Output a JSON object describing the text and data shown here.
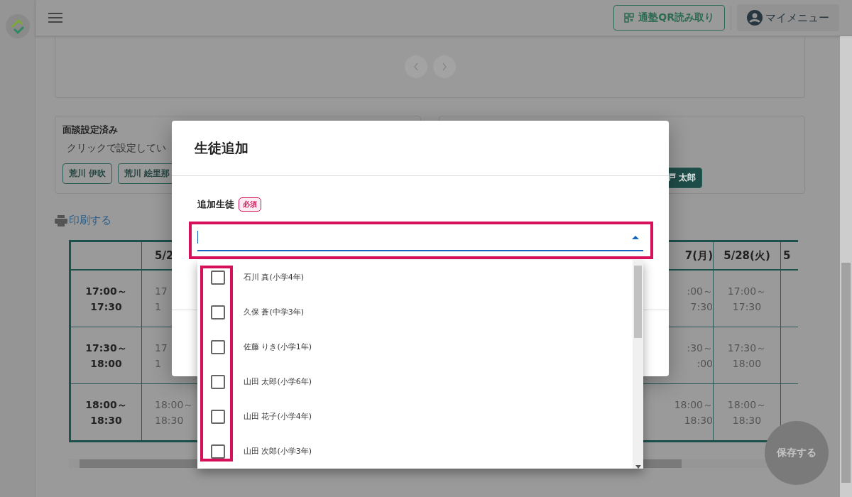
{
  "header": {
    "qr_button": "通塾QR読み取り",
    "my_menu": "マイメニュー"
  },
  "interview_set": {
    "title": "面談設定済み",
    "hint": "クリックで設定してい",
    "students": [
      "荒川 伊吹",
      "荒川 絵里那"
    ]
  },
  "other_panel": {
    "students": [
      "戸 太郎"
    ]
  },
  "print_link": "印刷する",
  "schedule": {
    "columns": [
      "",
      "5/2",
      "7(月)",
      "5/28(火)",
      "5"
    ],
    "rows": [
      {
        "cells": [
          [
            "17:00～",
            "17:30"
          ],
          [
            "17",
            "1"
          ],
          [
            ":00～",
            "7:30"
          ],
          [
            "17:00～",
            "17:30"
          ]
        ]
      },
      {
        "cells": [
          [
            "17:30～",
            "18:00"
          ],
          [
            "17",
            "1"
          ],
          [
            ":30～",
            ":00"
          ],
          [
            "17:30～",
            "18:00"
          ]
        ]
      },
      {
        "cells": [
          [
            "18:00～",
            "18:30"
          ],
          [
            "18:00～",
            "18:30"
          ],
          [
            "18:00～",
            "18:30"
          ],
          [
            "18:00～",
            "18:30"
          ]
        ]
      }
    ]
  },
  "save_button": {
    "label": "保存する",
    "disabled": true
  },
  "dialog": {
    "title": "生徒追加",
    "field": {
      "label": "追加生徒",
      "badge": "必須",
      "expanded": true
    },
    "options": [
      {
        "label": "石川 真(小学4年)",
        "checked": false
      },
      {
        "label": "久保 蒼(中学3年)",
        "checked": false
      },
      {
        "label": "佐藤 りき(小学1年)",
        "checked": false
      },
      {
        "label": "山田 太郎(小学6年)",
        "checked": false
      },
      {
        "label": "山田 花子(小学4年)",
        "checked": false
      },
      {
        "label": "山田 次郎(小学3年)",
        "checked": false
      }
    ]
  }
}
